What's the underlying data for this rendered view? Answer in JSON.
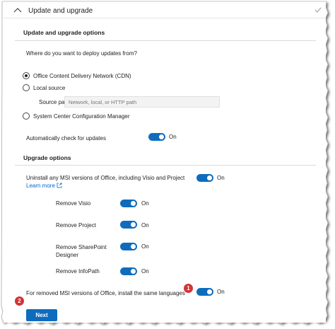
{
  "header": {
    "title": "Update and upgrade"
  },
  "update_options": {
    "title": "Update and upgrade options",
    "question": "Where do you want to deploy updates from?",
    "radios": [
      {
        "label": "Office Content Delivery Network (CDN)",
        "checked": true
      },
      {
        "label": "Local source",
        "checked": false
      },
      {
        "label": "System Center Configuration Manager",
        "checked": false
      }
    ],
    "source_path": {
      "label": "Source path",
      "placeholder": "Network, local, or HTTP path",
      "value": ""
    },
    "auto_check": {
      "label": "Automatically check for updates",
      "state": "On"
    }
  },
  "upgrade_options": {
    "title": "Upgrade options",
    "uninstall": {
      "label": "Uninstall any MSI versions of Office, including Visio and Project",
      "link": "Learn more",
      "state": "On"
    },
    "removes": [
      {
        "label": "Remove Visio",
        "state": "On"
      },
      {
        "label": "Remove Project",
        "state": "On"
      },
      {
        "label_line1": "Remove SharePoint",
        "label_line2": "Designer",
        "state": "On"
      },
      {
        "label": "Remove InfoPath",
        "state": "On"
      }
    ],
    "same_languages": {
      "label": "For removed MSI versions of Office, install the same languages",
      "state": "On",
      "badge": "1"
    }
  },
  "footer": {
    "next_label": "Next",
    "badge": "2"
  },
  "colors": {
    "accent": "#0f6cbd",
    "badge": "#d13438",
    "link": "#0066cc"
  }
}
